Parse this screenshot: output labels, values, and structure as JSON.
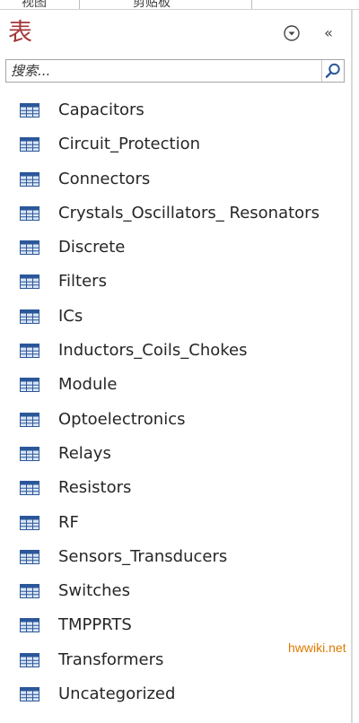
{
  "ribbon": {
    "view_label": "视图",
    "clipboard_label": "剪贴板"
  },
  "nav_pane": {
    "title": "表",
    "menu_icon": "dropdown-circle-icon",
    "collapse_label": "«",
    "search": {
      "placeholder": "搜索...",
      "value": ""
    },
    "item_icon": "table-icon",
    "items": [
      {
        "label": "Capacitors"
      },
      {
        "label": "Circuit_Protection"
      },
      {
        "label": "Connectors"
      },
      {
        "label": "Crystals_Oscillators_ Resonators"
      },
      {
        "label": "Discrete"
      },
      {
        "label": "Filters"
      },
      {
        "label": "ICs"
      },
      {
        "label": "Inductors_Coils_Chokes"
      },
      {
        "label": "Module"
      },
      {
        "label": "Optoelectronics"
      },
      {
        "label": "Relays"
      },
      {
        "label": "Resistors"
      },
      {
        "label": "RF"
      },
      {
        "label": "Sensors_Transducers"
      },
      {
        "label": "Switches"
      },
      {
        "label": "TMPPRTS"
      },
      {
        "label": "Transformers"
      },
      {
        "label": "Uncategorized"
      }
    ]
  },
  "watermark": "hwwiki.net",
  "colors": {
    "title": "#a4373a",
    "icon_blue": "#2b579a",
    "watermark": "#e07b00"
  }
}
